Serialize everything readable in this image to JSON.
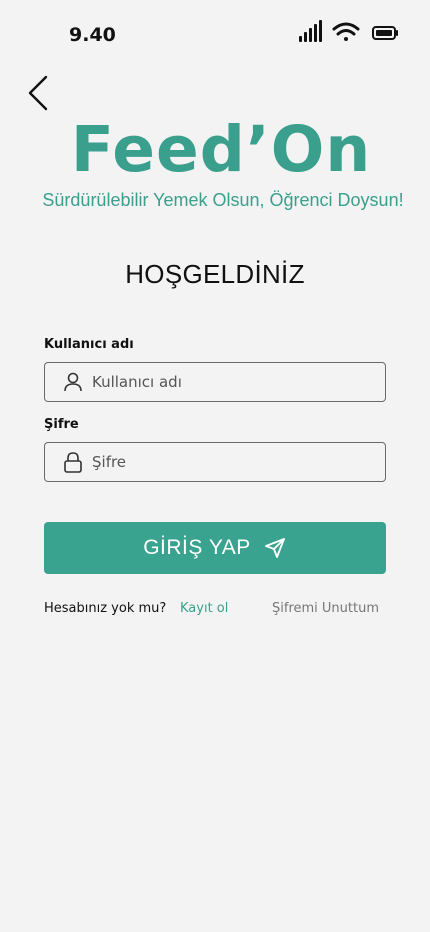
{
  "status_bar": {
    "time": "9.40",
    "icons": [
      "cellular-signal-icon",
      "wifi-icon",
      "battery-icon"
    ]
  },
  "nav": {
    "back_icon": "chevron-left-icon"
  },
  "brand": {
    "title": "Feed’On",
    "subtitle": "Sürdürülebilir Yemek Olsun, Öğrenci Doysun!",
    "color": "#3a9f8c"
  },
  "welcome": "HOŞGELDİNİZ",
  "form": {
    "username": {
      "label": "Kullanıcı adı",
      "placeholder": "Kullanıcı adı",
      "value": "",
      "icon": "user-icon"
    },
    "password": {
      "label": "Şifre",
      "placeholder": "Şifre",
      "value": "",
      "icon": "lock-icon"
    }
  },
  "login_button": {
    "label": "GİRİŞ YAP",
    "icon": "send-icon",
    "color": "#3aa38f"
  },
  "footer": {
    "no_account": "Hesabınız yok mu?",
    "signup": "Kayıt ol",
    "forgot": "Şifremi Unuttum"
  }
}
